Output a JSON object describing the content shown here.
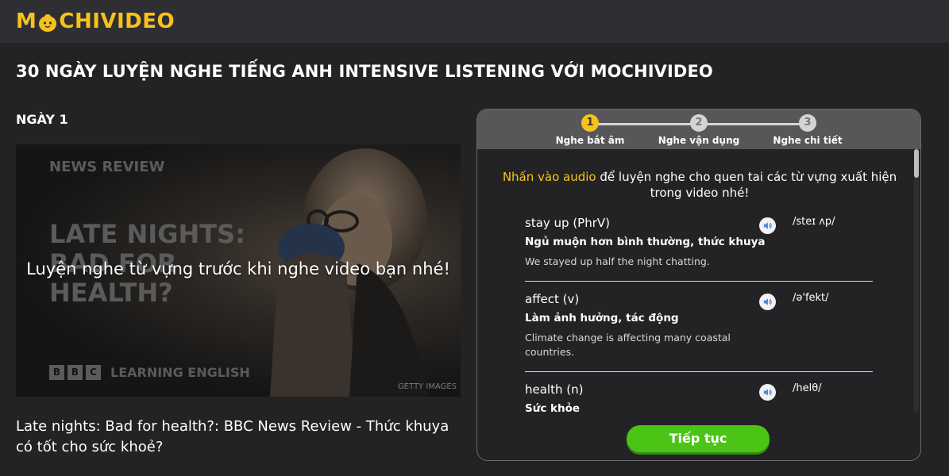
{
  "header": {
    "logo_text_left": "M",
    "logo_text_right": "CHIVIDEO",
    "logo_color": "#f7c21b"
  },
  "page": {
    "title": "30 NGÀY LUYỆN NGHE TIẾNG ANH INTENSIVE LISTENING VỚI MOCHIVIDEO",
    "day_label": "NGÀY 1"
  },
  "video": {
    "thumb_series": "NEWS REVIEW",
    "thumb_headline": "LATE NIGHTS:\nBAD FOR\nHEALTH?",
    "thumb_brand_boxes": [
      "B",
      "B",
      "C"
    ],
    "thumb_brand": "LEARNING ENGLISH",
    "thumb_credit": "GETTY IMAGES",
    "overlay_text": "Luyện nghe từ vựng trước khi nghe video bạn nhé!",
    "title": "Late nights: Bad for health?: BBC News Review - Thức khuya có tốt cho sức khoẻ?"
  },
  "stepper": {
    "steps": [
      {
        "number": "1",
        "label": "Nghe bắt âm",
        "active": true
      },
      {
        "number": "2",
        "label": "Nghe vận dụng",
        "active": false
      },
      {
        "number": "3",
        "label": "Nghe chi tiết",
        "active": false
      }
    ]
  },
  "panel": {
    "intro_highlight": "Nhấn vào audio",
    "intro_rest": " để luyện nghe cho quen tai các từ vựng xuất hiện trong video nhé!",
    "vocab": [
      {
        "word": "stay up (PhrV)",
        "ipa": "/steɪ ʌp/",
        "meaning": "Ngủ muộn hơn bình thường, thức khuya",
        "example": "We stayed up half the night chatting."
      },
      {
        "word": "affect (v)",
        "ipa": "/ə'fekt/",
        "meaning": "Làm ảnh hưởng, tác động",
        "example": "Climate change is affecting many coastal countries."
      },
      {
        "word": "health (n)",
        "ipa": "/helθ/",
        "meaning": "Sức khỏe",
        "example": ""
      }
    ],
    "continue_label": "Tiếp tục"
  },
  "colors": {
    "accent": "#f7c21b",
    "button_green": "#4cc415",
    "background": "#232326"
  }
}
